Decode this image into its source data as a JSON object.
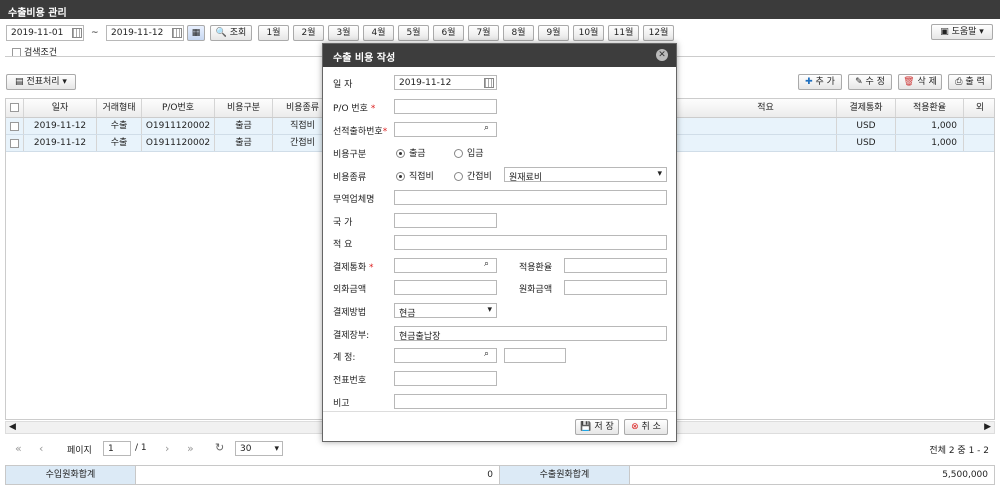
{
  "window": {
    "title": "수출비용 관리"
  },
  "toolbar": {
    "date_from": "2019-11-01",
    "tilde": "~",
    "date_to": "2019-11-12",
    "search_label": "조회",
    "months": [
      "1월",
      "2월",
      "3월",
      "4월",
      "5월",
      "6월",
      "7월",
      "8월",
      "9월",
      "10월",
      "11월",
      "12월"
    ],
    "help_label": "도움말"
  },
  "search_condition": "검색조건",
  "actions": {
    "slip_label": "전표처리",
    "add_label": "추 가",
    "edit_label": "수 정",
    "delete_label": "삭 제",
    "print_label": "출 력"
  },
  "grid": {
    "columns": [
      "일자",
      "거래형태",
      "P/O번호",
      "비용구분",
      "비용종류",
      "적요",
      "결제통화",
      "적용환율",
      "외"
    ],
    "rows": [
      {
        "date": "2019-11-12",
        "type": "수출",
        "po": "O1911120002",
        "cost_div": "출금",
        "cost_kind": "직접비",
        "memo": "",
        "currency": "USD",
        "rate": "1,000"
      },
      {
        "date": "2019-11-12",
        "type": "수출",
        "po": "O1911120002",
        "cost_div": "출금",
        "cost_kind": "간접비",
        "memo": "",
        "currency": "USD",
        "rate": "1,000"
      }
    ]
  },
  "pager": {
    "page_label": "페이지",
    "page_value": "1",
    "total_pages": "/ 1",
    "page_size": "30",
    "summary_text": "전체 2 중 1 - 2"
  },
  "summary": {
    "import_label": "수입원화합계",
    "import_value": "0",
    "export_label": "수출원화합계",
    "export_value": "5,500,000"
  },
  "modal": {
    "title": "수출 비용 작성",
    "labels": {
      "date": "일       자",
      "po": "P/O 번호",
      "shipment": "선적출하번호",
      "cost_div": "비용구분",
      "cost_kind": "비용종류",
      "trader": "무역업체명",
      "country": "국       가",
      "memo": "적       요",
      "currency": "결제통화",
      "rate": "적용환율",
      "foreign_amt": "외화금액",
      "won_amt": "원화금액",
      "pay_method": "결제방법",
      "ledger": "결제장부:",
      "account": "계       정:",
      "slip_no": "전표번호",
      "note": "비고"
    },
    "values": {
      "date": "2019-11-12",
      "radio_out": "출금",
      "radio_in": "입금",
      "radio_direct": "직접비",
      "radio_indirect": "간접비",
      "cost_kind_select": "원재료비",
      "pay_method": "현금",
      "ledger": "현금출납장"
    },
    "save_label": "저 장",
    "cancel_label": "취 소"
  }
}
